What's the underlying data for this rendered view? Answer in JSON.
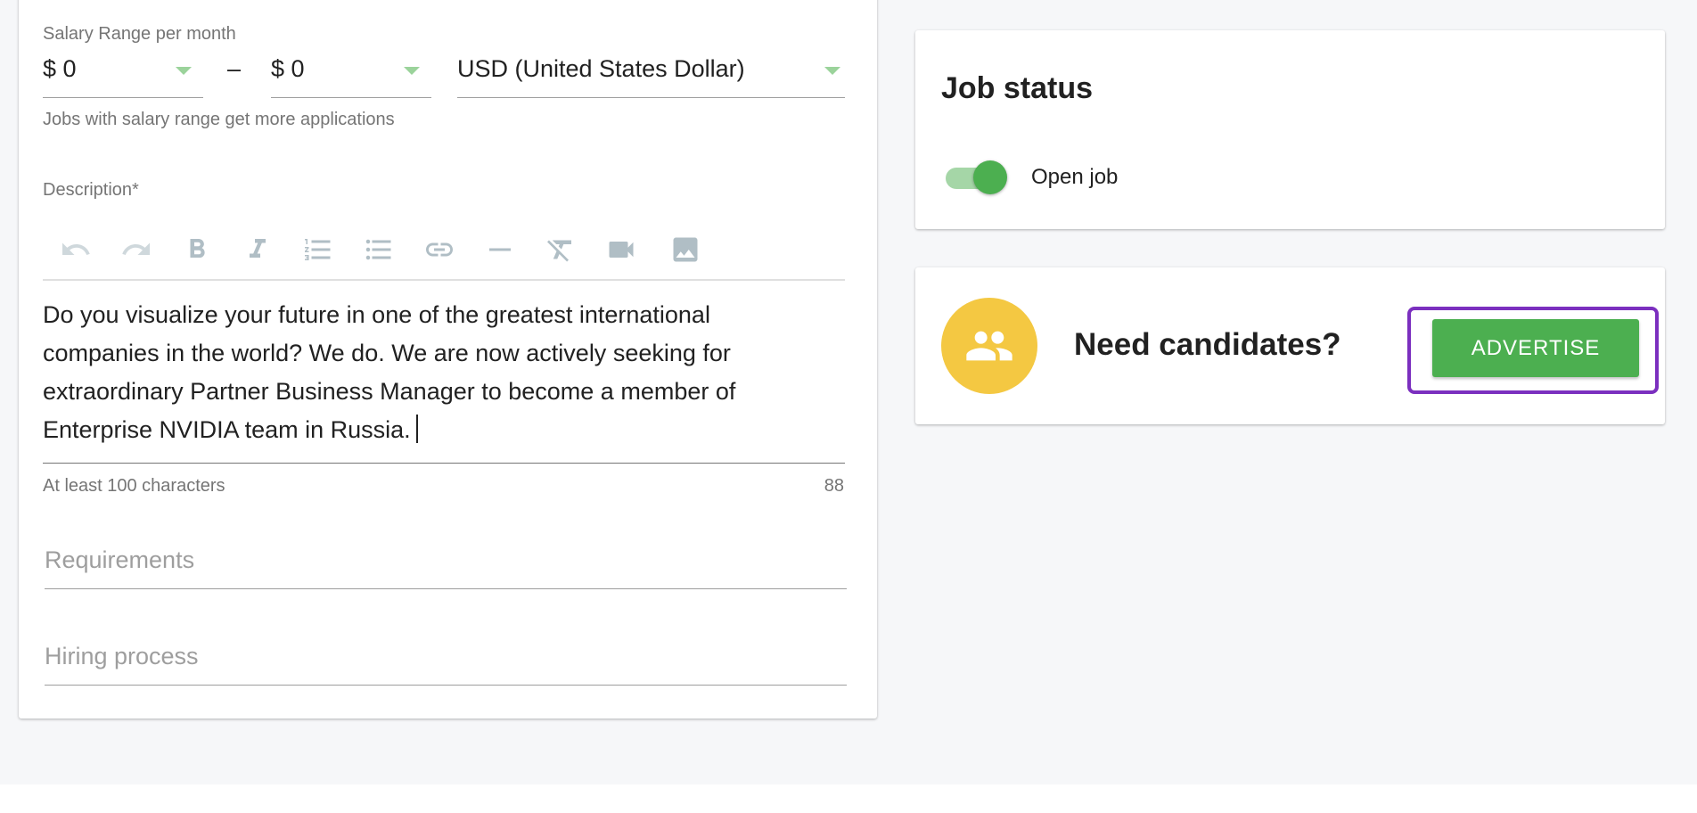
{
  "salary": {
    "label": "Salary Range per month",
    "min_value": "$ 0",
    "separator": "–",
    "max_value": "$ 0",
    "currency_value": "USD (United States Dollar)",
    "hint": "Jobs with salary range get more applications"
  },
  "description": {
    "label": "Description*",
    "toolbar": [
      "undo-icon",
      "redo-icon",
      "bold-icon",
      "italic-icon",
      "ordered-list-icon",
      "bullet-list-icon",
      "link-icon",
      "horizontal-rule-icon",
      "clear-format-icon",
      "video-icon",
      "image-icon"
    ],
    "text": "Do you visualize your future in one of the greatest international companies in the world? We do. We are now actively seeking for extraordinary Partner Business Manager to become a member of Enterprise NVIDIA team in Russia.",
    "hint": "At least 100 characters",
    "count": "88"
  },
  "requirements": {
    "placeholder": "Requirements"
  },
  "hiring_process": {
    "placeholder": "Hiring process"
  },
  "job_status": {
    "title": "Job status",
    "toggle_label": "Open job",
    "toggle_on": true
  },
  "candidates": {
    "title": "Need candidates?",
    "button_label": "ADVERTISE",
    "icon": "people-icon"
  },
  "colors": {
    "accent_green": "#4caf50",
    "avatar_yellow": "#f4c842",
    "highlight_purple": "#7b2fbf"
  }
}
